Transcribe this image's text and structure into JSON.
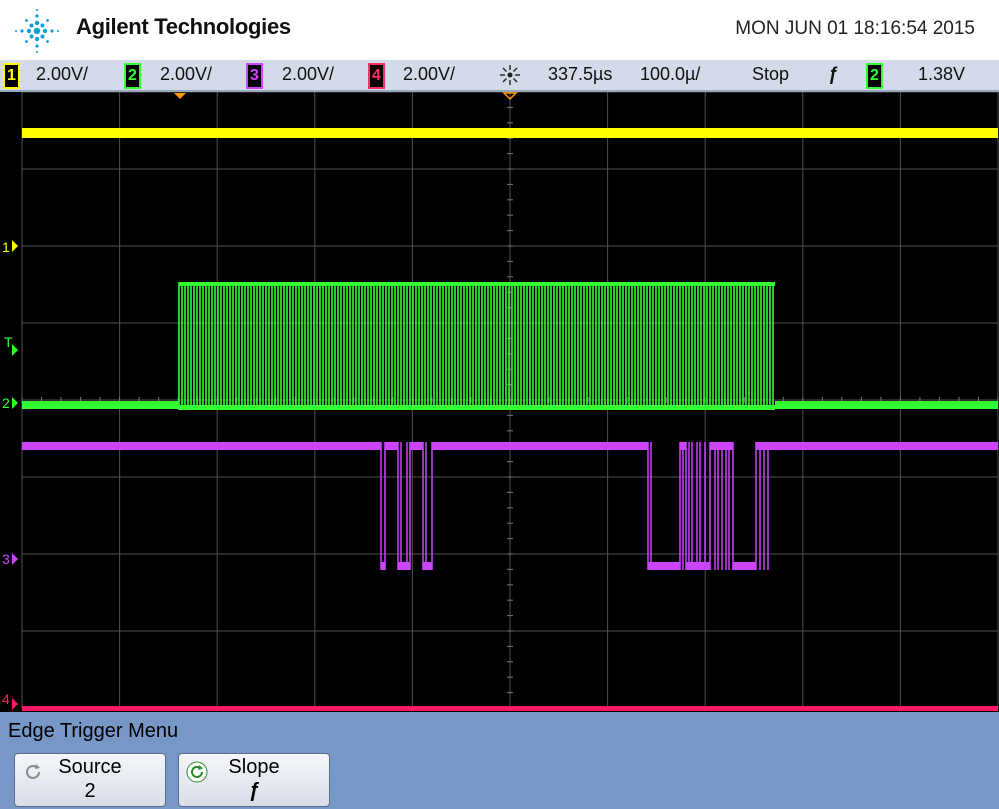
{
  "header": {
    "brand": "Agilent Technologies",
    "datetime": "MON JUN 01 18:16:54 2015"
  },
  "status": {
    "channels": [
      {
        "num": "1",
        "scale": "2.00V/",
        "color": "#ffff00"
      },
      {
        "num": "2",
        "scale": "2.00V/",
        "color": "#33ff33"
      },
      {
        "num": "3",
        "scale": "2.00V/",
        "color": "#cc44ff"
      },
      {
        "num": "4",
        "scale": "2.00V/",
        "color": "#ff3366"
      }
    ],
    "time_icon": "sun-burst-icon",
    "time_offset": "337.5µs",
    "time_scale": "100.0µ/",
    "run_state": "Stop",
    "trigger_slope_symbol": "ƒ",
    "trigger_channel": "2",
    "trigger_level": "1.38V"
  },
  "screen": {
    "markers": {
      "ch1": "1",
      "trigger": "T",
      "ch2": "2",
      "ch3": "3",
      "ch4": "4"
    },
    "colors": {
      "ch1": "#ffff00",
      "ch2": "#33ff33",
      "ch3": "#cc44ff",
      "ch4": "#ff1a66",
      "grid": "#505050",
      "trigger_marker": "#ff9900"
    }
  },
  "menu": {
    "title": "Edge Trigger Menu",
    "source_label": "Source",
    "source_value": "2",
    "slope_label": "Slope",
    "slope_value": "ƒ"
  }
}
